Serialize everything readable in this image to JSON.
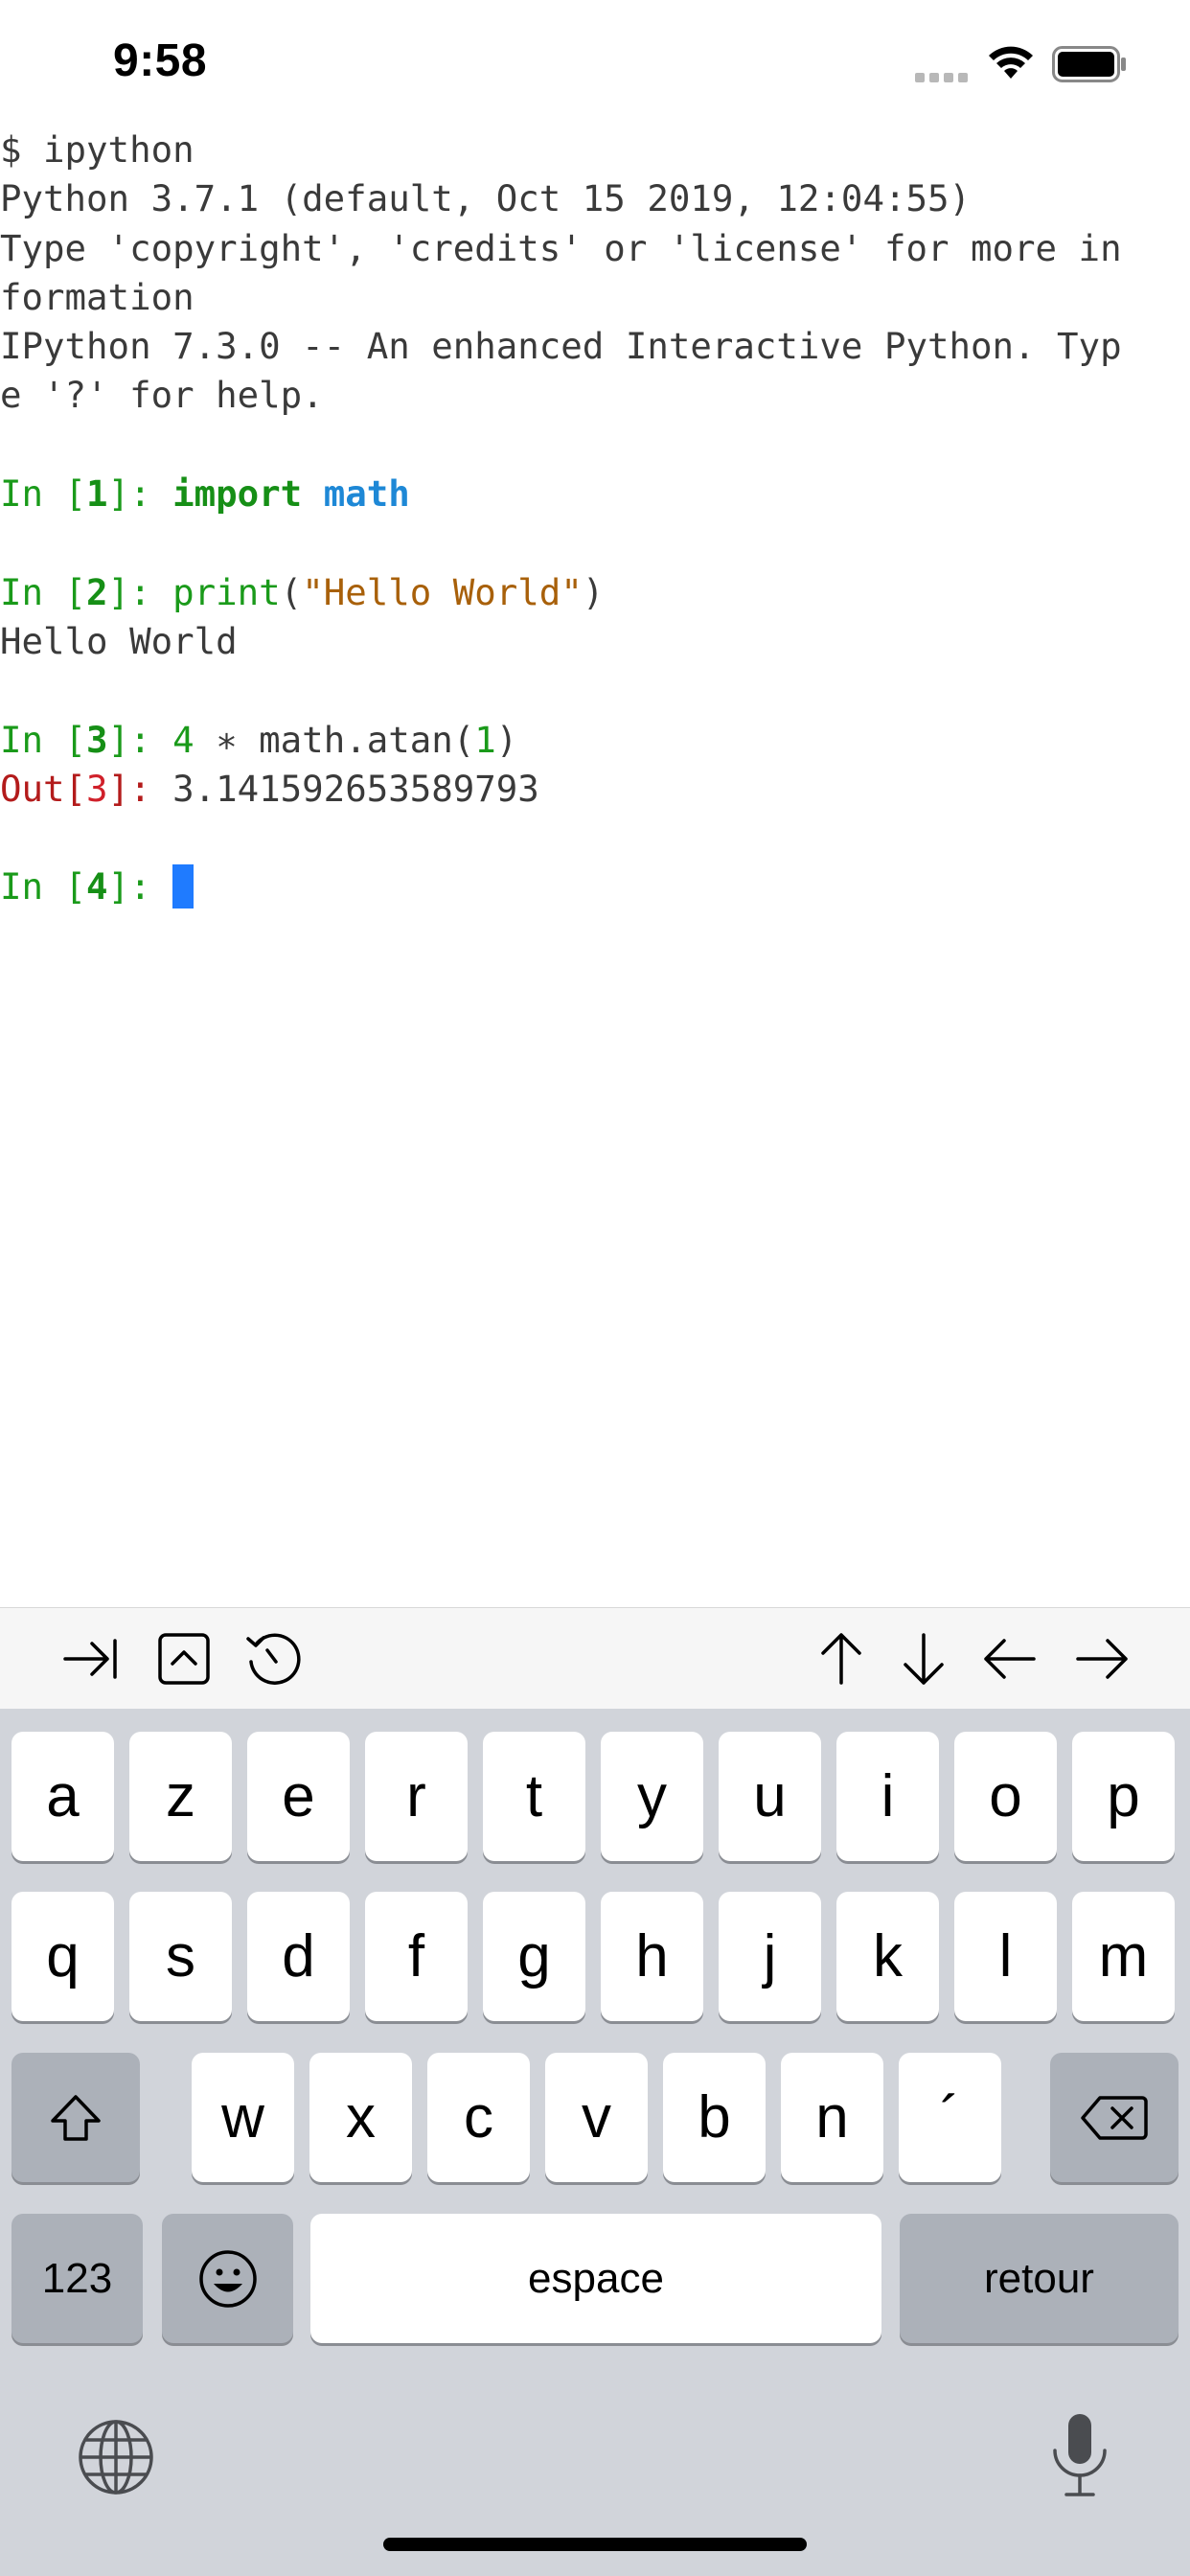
{
  "status_bar": {
    "time": "9:58",
    "icons": [
      "signal-icon",
      "wifi-icon",
      "battery-icon"
    ]
  },
  "terminal": {
    "lines": [
      [
        {
          "t": "$ ipython",
          "c": ""
        }
      ],
      [
        {
          "t": "Python 3.7.1 (default, Oct 15 2019, 12:04:55)",
          "c": ""
        }
      ],
      [
        {
          "t": "Type 'copyright', 'credits' or 'license' for more in",
          "c": ""
        }
      ],
      [
        {
          "t": "formation",
          "c": ""
        }
      ],
      [
        {
          "t": "IPython 7.3.0 -- An enhanced Interactive Python. Typ",
          "c": ""
        }
      ],
      [
        {
          "t": "e '?' for help.",
          "c": ""
        }
      ],
      [
        {
          "t": "",
          "c": ""
        }
      ],
      [
        {
          "t": "In [",
          "c": "g"
        },
        {
          "t": "1",
          "c": "gb"
        },
        {
          "t": "]: ",
          "c": "g"
        },
        {
          "t": "import",
          "c": "gb"
        },
        {
          "t": " ",
          "c": ""
        },
        {
          "t": "math",
          "c": "b"
        }
      ],
      [
        {
          "t": "",
          "c": ""
        }
      ],
      [
        {
          "t": "In [",
          "c": "g"
        },
        {
          "t": "2",
          "c": "gb"
        },
        {
          "t": "]: ",
          "c": "g"
        },
        {
          "t": "print",
          "c": "g"
        },
        {
          "t": "(",
          "c": ""
        },
        {
          "t": "\"Hello World\"",
          "c": "o"
        },
        {
          "t": ")",
          "c": ""
        }
      ],
      [
        {
          "t": "Hello World",
          "c": ""
        }
      ],
      [
        {
          "t": "",
          "c": ""
        }
      ],
      [
        {
          "t": "In [",
          "c": "g"
        },
        {
          "t": "3",
          "c": "gb"
        },
        {
          "t": "]: ",
          "c": "g"
        },
        {
          "t": "4",
          "c": "g"
        },
        {
          "t": " ∗ math.atan(",
          "c": ""
        },
        {
          "t": "1",
          "c": "g"
        },
        {
          "t": ")",
          "c": ""
        }
      ],
      [
        {
          "t": "Out[",
          "c": "r"
        },
        {
          "t": "3",
          "c": "rb"
        },
        {
          "t": "]: ",
          "c": "r"
        },
        {
          "t": "3.141592653589793",
          "c": ""
        }
      ],
      [
        {
          "t": "",
          "c": ""
        }
      ],
      [
        {
          "t": "In [",
          "c": "g"
        },
        {
          "t": "4",
          "c": "gb"
        },
        {
          "t": "]: ",
          "c": "g"
        },
        {
          "t": "",
          "c": "cursor"
        }
      ]
    ]
  },
  "toolbar": {
    "left_buttons": [
      "tab-icon",
      "control-icon",
      "history-icon"
    ],
    "right_buttons": [
      "arrow-up-icon",
      "arrow-down-icon",
      "arrow-left-icon",
      "arrow-right-icon"
    ]
  },
  "keyboard": {
    "row1": [
      "a",
      "z",
      "e",
      "r",
      "t",
      "y",
      "u",
      "i",
      "o",
      "p"
    ],
    "row2": [
      "q",
      "s",
      "d",
      "f",
      "g",
      "h",
      "j",
      "k",
      "l",
      "m"
    ],
    "row3": [
      "w",
      "x",
      "c",
      "v",
      "b",
      "n",
      "´"
    ],
    "numbers_label": "123",
    "space_label": "espace",
    "return_label": "retour"
  },
  "colors": {
    "cursor": "#1f7bff",
    "prompt_green": "#1a9a1a",
    "keyword_blue": "#1e88d6",
    "string_orange": "#a8600a",
    "out_red": "#b31b1b",
    "keyboard_bg": "#d1d4da"
  }
}
